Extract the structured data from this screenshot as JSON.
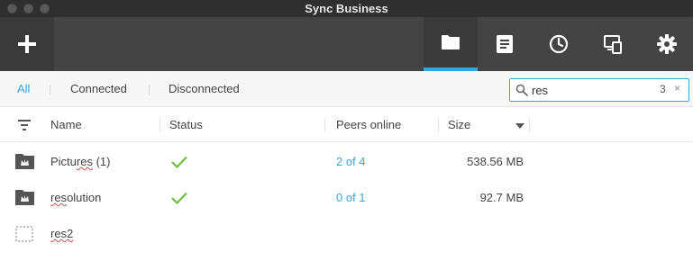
{
  "window": {
    "title": "Sync Business"
  },
  "toolbar": {
    "buttons": [
      {
        "icon": "add-icon"
      },
      {
        "icon": "folder-icon",
        "active": true
      },
      {
        "icon": "document-icon"
      },
      {
        "icon": "clock-icon"
      },
      {
        "icon": "devices-icon"
      },
      {
        "icon": "gear-icon"
      }
    ],
    "accent": "#38a7d6"
  },
  "filters": {
    "all": "All",
    "connected": "Connected",
    "disconnected": "Disconnected"
  },
  "search": {
    "value": "res",
    "count": "3",
    "clear": "×"
  },
  "table": {
    "columns": {
      "name": "Name",
      "status": "Status",
      "peers": "Peers online",
      "size": "Size"
    },
    "rows": [
      {
        "name_match": "Pictu",
        "name_highlight": "res",
        "name_rest": " (1)",
        "status": "synced",
        "peers": "2 of 4",
        "size": "538.56 MB"
      },
      {
        "name_match": "",
        "name_highlight": "res",
        "name_rest": "olution",
        "status": "synced",
        "peers": "0 of 1",
        "size": "92.7 MB"
      },
      {
        "name_match": "",
        "name_highlight": "res2",
        "name_rest": "",
        "status": "",
        "peers": "",
        "size": ""
      }
    ]
  },
  "colors": {
    "status_ok": "#6cbf43",
    "toolbar_bg": "#444444"
  }
}
